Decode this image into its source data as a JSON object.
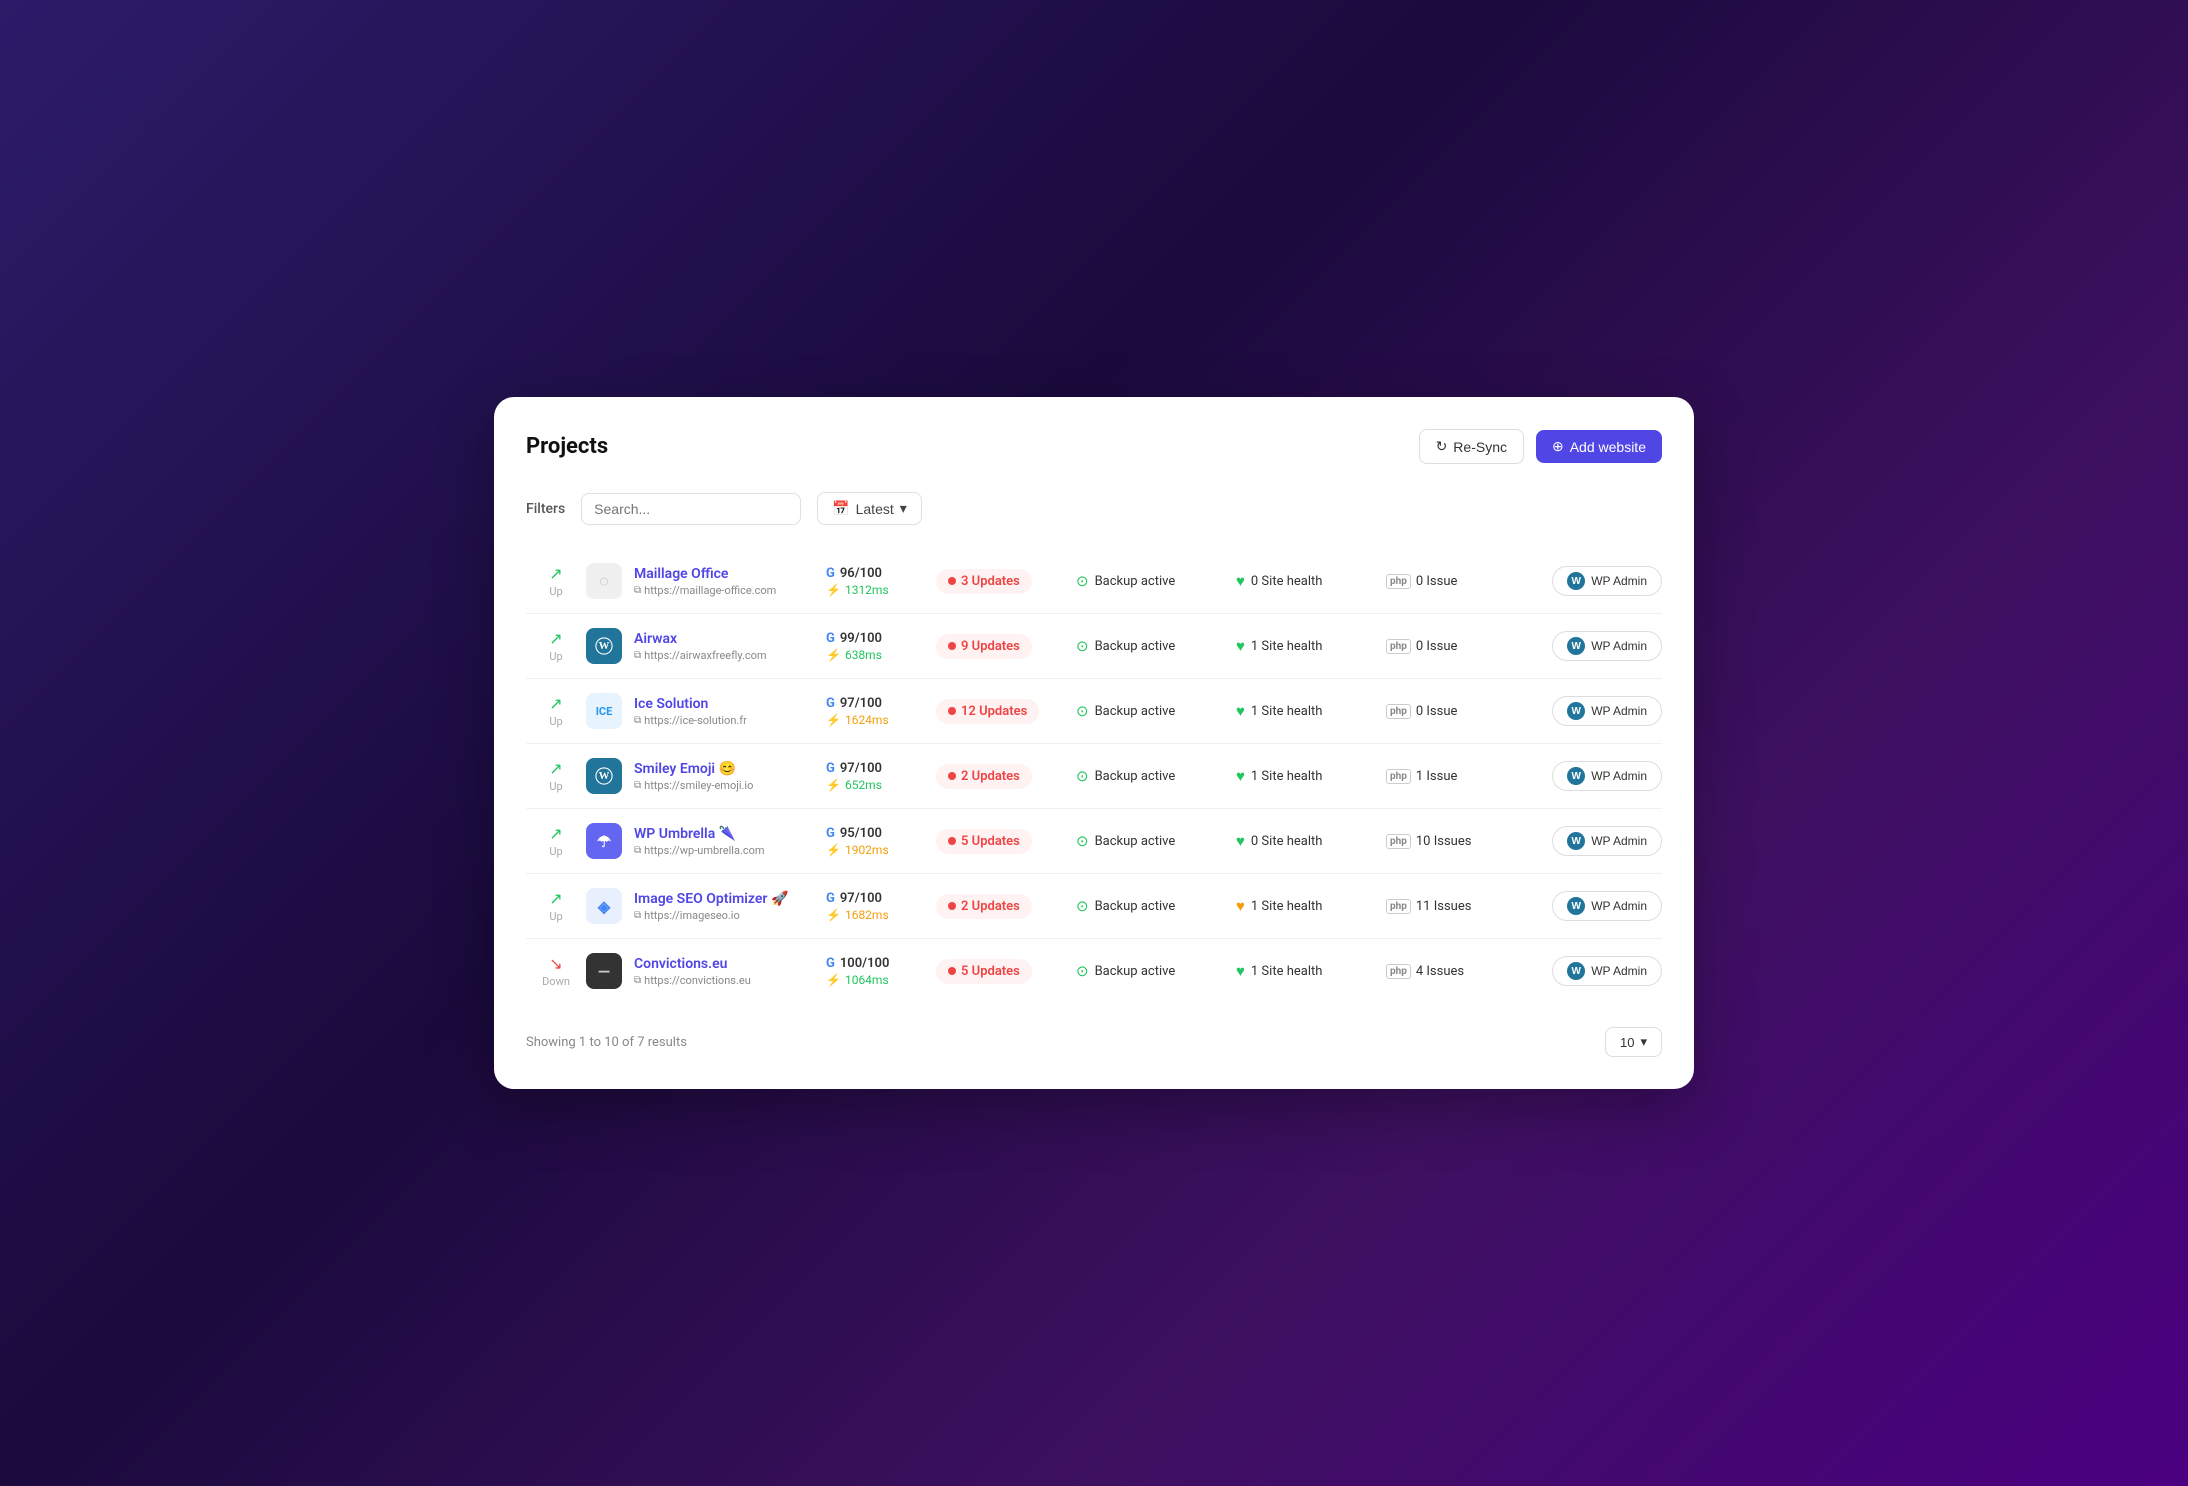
{
  "header": {
    "title": "Projects",
    "resync_label": "Re-Sync",
    "add_website_label": "Add website"
  },
  "filters": {
    "label": "Filters",
    "search_placeholder": "Search...",
    "latest_label": "Latest"
  },
  "projects": [
    {
      "id": 1,
      "status": "Up",
      "status_direction": "up",
      "name": "Maillage Office",
      "url": "https://maillage-office.com",
      "logo_type": "default",
      "logo_text": "",
      "score": "96/100",
      "speed": "1312ms",
      "speed_color": "green",
      "updates": "3 Updates",
      "backup": "Backup active",
      "health_count": "0 Site health",
      "health_color": "green",
      "issues": "0 Issue",
      "wp_admin": "WP Admin"
    },
    {
      "id": 2,
      "status": "Up",
      "status_direction": "up",
      "name": "Airwax",
      "url": "https://airwaxfreefly.com",
      "logo_type": "wp",
      "logo_text": "W",
      "score": "99/100",
      "speed": "638ms",
      "speed_color": "green",
      "updates": "9 Updates",
      "backup": "Backup active",
      "health_count": "1 Site health",
      "health_color": "green",
      "issues": "0 Issue",
      "wp_admin": "WP Admin"
    },
    {
      "id": 3,
      "status": "Up",
      "status_direction": "up",
      "name": "Ice Solution",
      "url": "https://ice-solution.fr",
      "logo_type": "ice",
      "logo_text": "ICE",
      "score": "97/100",
      "speed": "1624ms",
      "speed_color": "orange",
      "updates": "12 Updates",
      "backup": "Backup active",
      "health_count": "1 Site health",
      "health_color": "green",
      "issues": "0 Issue",
      "wp_admin": "WP Admin"
    },
    {
      "id": 4,
      "status": "Up",
      "status_direction": "up",
      "name": "Smiley Emoji 😊",
      "url": "https://smiley-emoji.io",
      "logo_type": "wp",
      "logo_text": "W",
      "score": "97/100",
      "speed": "652ms",
      "speed_color": "green",
      "updates": "2 Updates",
      "backup": "Backup active",
      "health_count": "1 Site health",
      "health_color": "green",
      "issues": "1 Issue",
      "wp_admin": "WP Admin"
    },
    {
      "id": 5,
      "status": "Up",
      "status_direction": "up",
      "name": "WP Umbrella 🌂",
      "url": "https://wp-umbrella.com",
      "logo_type": "umbrella",
      "logo_text": "U",
      "score": "95/100",
      "speed": "1902ms",
      "speed_color": "orange",
      "updates": "5 Updates",
      "backup": "Backup active",
      "health_count": "0 Site health",
      "health_color": "green",
      "issues": "10 Issues",
      "wp_admin": "WP Admin"
    },
    {
      "id": 6,
      "status": "Up",
      "status_direction": "up",
      "name": "Image SEO Optimizer 🚀",
      "url": "https://imageseo.io",
      "logo_type": "seo",
      "logo_text": "◈",
      "score": "97/100",
      "speed": "1682ms",
      "speed_color": "orange",
      "updates": "2 Updates",
      "backup": "Backup active",
      "health_count": "1 Site health",
      "health_color": "orange",
      "issues": "11 Issues",
      "wp_admin": "WP Admin"
    },
    {
      "id": 7,
      "status": "Down",
      "status_direction": "down",
      "name": "Convictions.eu",
      "url": "https://convictions.eu",
      "logo_type": "convictions",
      "logo_text": "—",
      "score": "100/100",
      "speed": "1064ms",
      "speed_color": "green",
      "updates": "5 Updates",
      "backup": "Backup active",
      "health_count": "1 Site health",
      "health_color": "green",
      "issues": "4 Issues",
      "wp_admin": "WP Admin"
    }
  ],
  "footer": {
    "showing_text": "Showing 1 to 10 of 7 results",
    "per_page": "10"
  }
}
